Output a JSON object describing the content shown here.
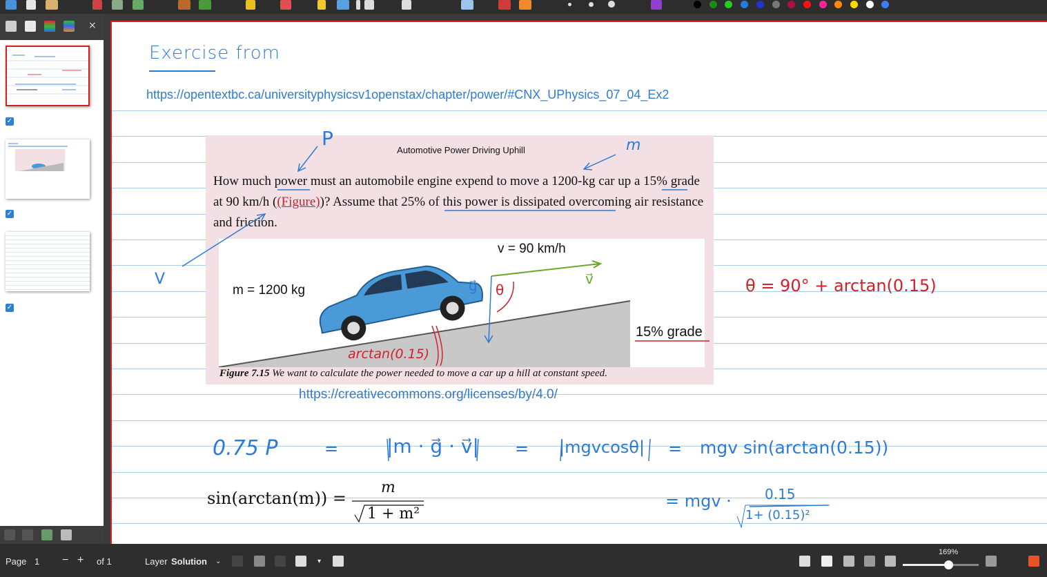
{
  "toolbar": {
    "pen_colors": [
      "#000000",
      "#1b8a1b",
      "#22cc22",
      "#1f7fe0",
      "#2233cc",
      "#777777",
      "#aa1144",
      "#ff1111",
      "#ff2299",
      "#ff8800",
      "#ffd800",
      "#ffffff",
      "#3c7ff0"
    ]
  },
  "sidebar": {
    "pages": [
      {
        "selected": true,
        "checked": true
      },
      {
        "selected": false,
        "checked": true
      },
      {
        "selected": false,
        "checked": true
      }
    ]
  },
  "page": {
    "heading": "Exercise from",
    "source_url": "https://opentextbc.ca/universityphysicsv1openstax/chapter/power/#CNX_UPhysics_07_04_Ex2",
    "license_url": "https://creativecommons.org/licenses/by/4.0/",
    "annotations": {
      "p": "P",
      "m": "m",
      "v": "V",
      "theta_eq": "θ = 90° + arctan(0.15)",
      "eq_lhs": "0.75 P",
      "eq_sign1": "=",
      "eq_abs_dot": "|m · g⃗ · v⃗|",
      "eq_sign2": "=",
      "eq_abs_cos": "|mgvcosθ|",
      "eq_sign3": "=",
      "eq_sin": "mgv sin(arctan(0.15))",
      "eq2_lhs": "= mgv ·",
      "eq2_num": "0.15",
      "eq2_den": "1+ (0.15)²",
      "formula_lhs": "sin(arctan(m)) =",
      "formula_num": "m",
      "formula_den": "1 + m²"
    },
    "figure": {
      "title": "Automotive Power Driving Uphill",
      "text_1": "How much power must an automobile engine expend to move a 1200-kg car up a 15% grade at 90 km/h (",
      "text_link": "(Figure)",
      "text_2": ")? Assume that 25% of this power is dissipated overcoming air resistance and friction.",
      "velocity_label": "v = 90 km/h",
      "mass_label": "m = 1200 kg",
      "grade_label": "15% grade",
      "hand_g": "g⃗",
      "hand_v": "v⃗",
      "hand_theta": "θ",
      "hand_arctan": "arctan(0.15)",
      "caption_bold": "Figure 7.15",
      "caption_text": "We want to calculate the power needed to move a car up a hill at constant speed."
    }
  },
  "statusbar": {
    "page_label": "Page",
    "page_value": "1",
    "minus": "−",
    "plus": "+",
    "of_label": "of 1",
    "layer_label": "Layer",
    "layer_value": "Solution",
    "zoom_label": "169%",
    "zoom_fraction": 0.6
  }
}
